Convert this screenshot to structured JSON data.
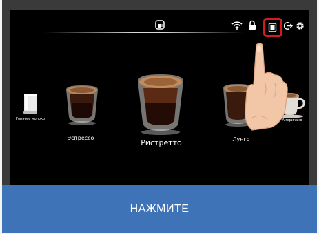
{
  "screen": {
    "drinks": [
      {
        "label": "Горячее молоко"
      },
      {
        "label": "Эспрессо"
      },
      {
        "label": "Ристретто"
      },
      {
        "label": "Лунго"
      },
      {
        "label": "Американо"
      }
    ],
    "status_icons": [
      "coffee-cup-icon",
      "wifi-icon",
      "lock-icon",
      "tablet-icon",
      "exit-icon",
      "gear-icon"
    ],
    "highlighted_icon": "tablet-icon",
    "highlight_color": "#d91a1a"
  },
  "banner": {
    "text": "НАЖМИТЕ",
    "color": "#3f73b7"
  }
}
